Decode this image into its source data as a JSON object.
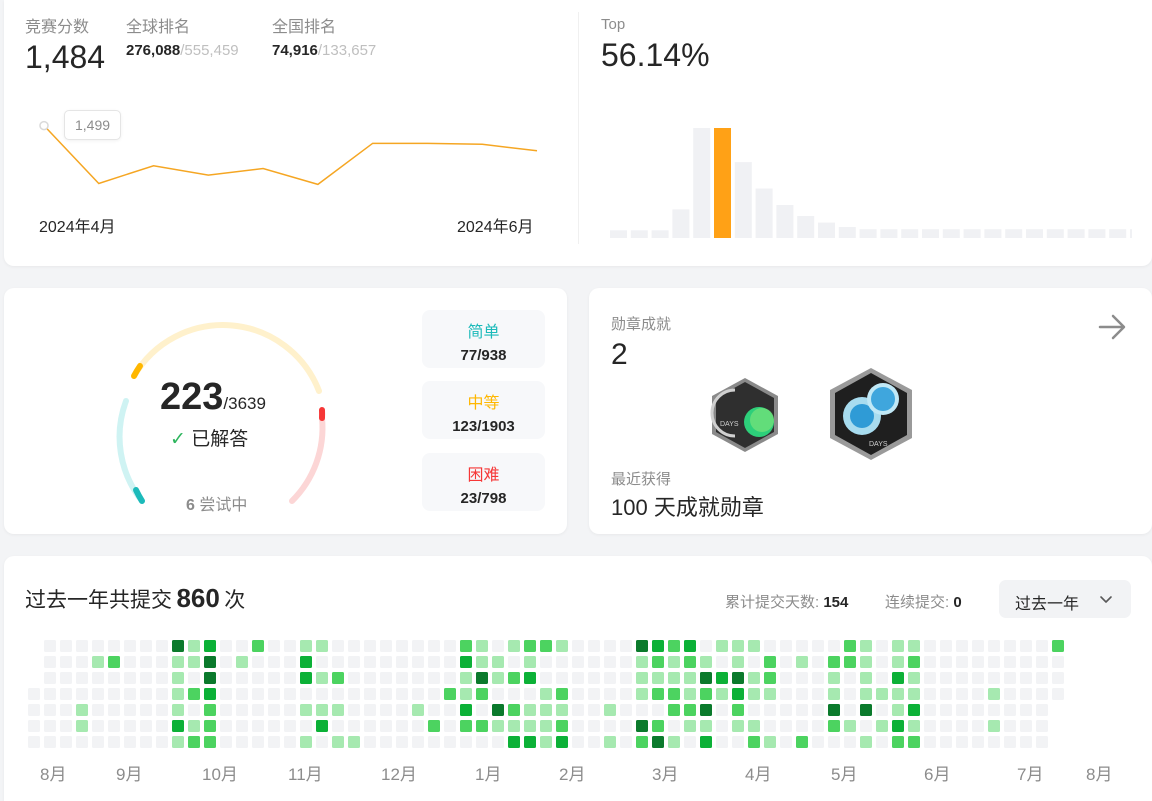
{
  "contest": {
    "score_label": "竞赛分数",
    "score": "1,484",
    "global_label": "全球排名",
    "global_rank": "276,088",
    "global_total": "/555,459",
    "national_label": "全国排名",
    "national_rank": "74,916",
    "national_total": "/133,657",
    "tooltip": "1,499",
    "date_start": "2024年4月",
    "date_end": "2024年6月",
    "rating_history": [
      1499,
      1437,
      1456,
      1446,
      1453,
      1436,
      1480,
      1480,
      1479,
      1472
    ],
    "top_label": "Top",
    "top_percent": "56.14%",
    "distribution": [
      0.07,
      0.07,
      0.07,
      0.26,
      1.0,
      1.0,
      0.69,
      0.45,
      0.3,
      0.2,
      0.14,
      0.1,
      0.08,
      0.08,
      0.08,
      0.08,
      0.08,
      0.08,
      0.08,
      0.08,
      0.08,
      0.08,
      0.08,
      0.08,
      0.08,
      0.08
    ],
    "highlight_index": 5,
    "colors": {
      "line": "#f5a623",
      "highlight": "#ffa116",
      "bar": "#f0f1f4"
    }
  },
  "solved": {
    "count": "223",
    "total": "/3639",
    "solved_label": "已解答",
    "attempting_count": "6",
    "attempting_label": "尝试中",
    "easy": {
      "label": "简单",
      "value": "77/938",
      "color": "#1cbaba"
    },
    "medium": {
      "label": "中等",
      "value": "123/1903",
      "color": "#ffb700"
    },
    "hard": {
      "label": "困难",
      "value": "23/798",
      "color": "#f63737"
    }
  },
  "badges": {
    "title": "勋章成就",
    "count": "2",
    "badge1_text": "DAYS",
    "badge2_text": "DAYS",
    "recent_label": "最近获得",
    "recent_name": "100 天成就勋章"
  },
  "submissions": {
    "prefix": "过去一年共提交",
    "count": "860",
    "suffix": "次",
    "total_days_label": "累计提交天数:",
    "total_days": "154",
    "streak_label": "连续提交:",
    "streak": "0",
    "range": "过去一年",
    "months": [
      "8月",
      "9月",
      "10月",
      "11月",
      "12月",
      "1月",
      "2月",
      "3月",
      "4月",
      "5月",
      "6月",
      "7月",
      "8月"
    ],
    "colors": [
      "#f2f3f5",
      "#a6e9b0",
      "#4cd360",
      "#0cb137",
      "#0b7a2c"
    ]
  }
}
